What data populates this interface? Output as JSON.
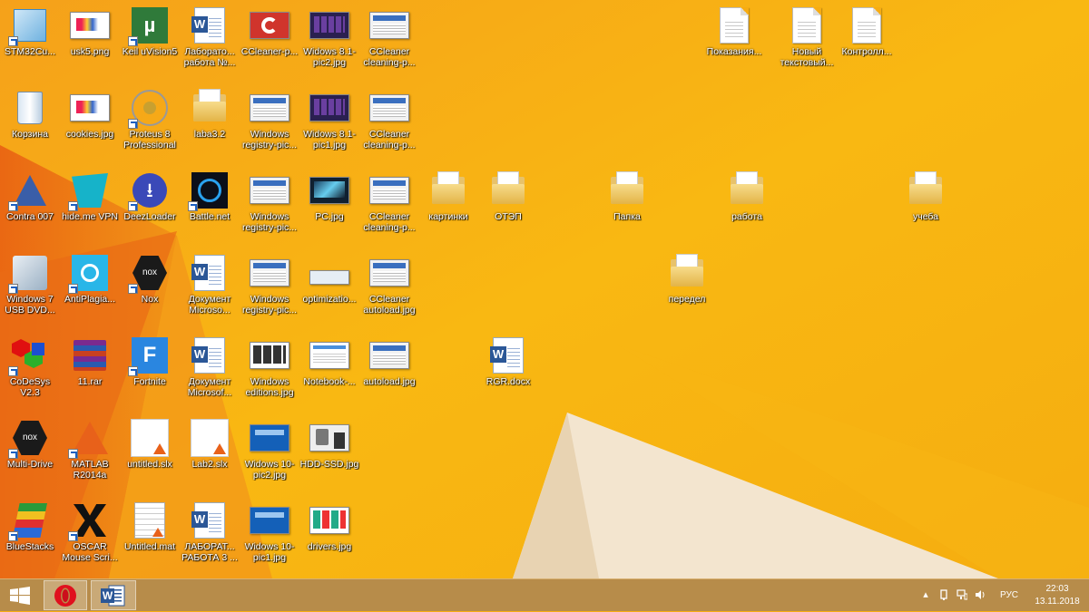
{
  "desktop": {
    "icons": [
      {
        "label": "STM32Cu...",
        "kind": "cube"
      },
      {
        "label": "usk5.png",
        "kind": "image"
      },
      {
        "label": "Keil uVision5",
        "kind": "keil"
      },
      {
        "label": "Лаборато... работа №...",
        "kind": "word"
      },
      {
        "label": "CCleaner-p...",
        "kind": "ccleaner"
      },
      {
        "label": "Widows 8.1-pic2.jpg",
        "kind": "darkthumb"
      },
      {
        "label": "CCleaner cleaning-p...",
        "kind": "lightthumb"
      },
      {
        "label": "Корзина",
        "kind": "recycle"
      },
      {
        "label": "cookies.jpg",
        "kind": "image"
      },
      {
        "label": "Proteus 8 Professional",
        "kind": "proteus"
      },
      {
        "label": "laba3.2",
        "kind": "folder"
      },
      {
        "label": "Windows registry-pic...",
        "kind": "lightthumb"
      },
      {
        "label": "Widows 8.1-pic1.jpg",
        "kind": "darkthumb"
      },
      {
        "label": "CCleaner cleaning-p...",
        "kind": "lightthumb"
      },
      {
        "label": "Contra 007",
        "kind": "contra"
      },
      {
        "label": "hide.me VPN",
        "kind": "vpn"
      },
      {
        "label": "DeezLoader",
        "kind": "deez"
      },
      {
        "label": "Battle.net",
        "kind": "battle"
      },
      {
        "label": "Windows registry-pic...",
        "kind": "lightthumb"
      },
      {
        "label": "PC.jpg",
        "kind": "pcthumb"
      },
      {
        "label": "CCleaner cleaning-p...",
        "kind": "lightthumb"
      },
      {
        "label": "картинки",
        "kind": "folder"
      },
      {
        "label": "ОТЭП",
        "kind": "folder"
      },
      {
        "label": "Папка",
        "kind": "folder"
      },
      {
        "label": "работа",
        "kind": "folder"
      },
      {
        "label": "учеба",
        "kind": "folder"
      },
      {
        "label": "Windows 7 USB DVD...",
        "kind": "win7"
      },
      {
        "label": "AntiPlagia...",
        "kind": "antiplag"
      },
      {
        "label": "Nox",
        "kind": "nox"
      },
      {
        "label": "Документ Microso...",
        "kind": "word"
      },
      {
        "label": "Windows registry-pic...",
        "kind": "lightthumb"
      },
      {
        "label": "optimizatio...",
        "kind": "optthumb"
      },
      {
        "label": "CCleaner autoload.jpg",
        "kind": "lightthumb"
      },
      {
        "label": "передел",
        "kind": "folder"
      },
      {
        "label": "CoDeSys V2.3",
        "kind": "codesys"
      },
      {
        "label": "11.rar",
        "kind": "rar"
      },
      {
        "label": "Fortnite",
        "kind": "fortnite"
      },
      {
        "label": "Документ Microsof...",
        "kind": "word"
      },
      {
        "label": "Windows editions.jpg",
        "kind": "editions"
      },
      {
        "label": "Notebook-...",
        "kind": "notebook"
      },
      {
        "label": "autoload.jpg",
        "kind": "lightthumb"
      },
      {
        "label": "RGR.docx",
        "kind": "word"
      },
      {
        "label": "Multi-Drive",
        "kind": "nox"
      },
      {
        "label": "MATLAB R2014a",
        "kind": "matlab"
      },
      {
        "label": "untitled.slx",
        "kind": "slx"
      },
      {
        "label": "Lab2.slx",
        "kind": "slx"
      },
      {
        "label": "Widows 10-pic2.jpg",
        "kind": "bluethumb"
      },
      {
        "label": "HDD-SSD.jpg",
        "kind": "hddthumb"
      },
      {
        "label": "BlueStacks",
        "kind": "bluestacks"
      },
      {
        "label": "OSCAR Mouse Scri...",
        "kind": "oscar"
      },
      {
        "label": "Untitled.mat",
        "kind": "mat"
      },
      {
        "label": "ЛАБОРАТ... РАБОТА 3 ...",
        "kind": "word"
      },
      {
        "label": "Widows 10-pic1.jpg",
        "kind": "bluethumb"
      },
      {
        "label": "drivers.jpg",
        "kind": "driversthumb"
      },
      {
        "label": "Показания...",
        "kind": "textdoc"
      },
      {
        "label": "Новый текстовый...",
        "kind": "textdoc"
      },
      {
        "label": "Контролл...",
        "kind": "textdoc"
      }
    ]
  },
  "taskbar": {
    "start": "start-icon",
    "pinned": [
      "opera-icon",
      "word-icon"
    ],
    "tray": {
      "icons": [
        "chevron-up-icon",
        "power-plug-icon",
        "network-icon",
        "volume-icon"
      ],
      "language": "РУС",
      "time": "22:03",
      "date": "13.11.2018"
    }
  },
  "colors": {
    "wallpaper": "#f7ac12",
    "orange": "#ee7d1a",
    "cream": "#f3e5cf",
    "taskbar": "#b78c4a"
  }
}
